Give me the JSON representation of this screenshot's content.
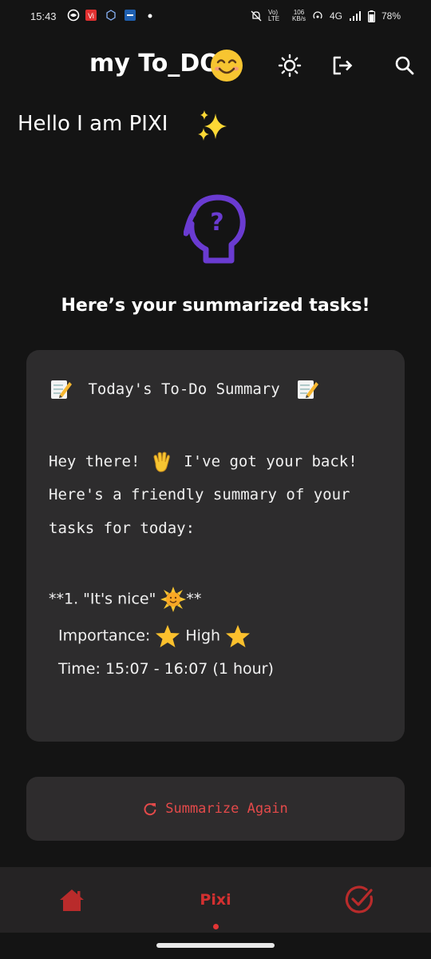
{
  "status_bar": {
    "time": "15:43",
    "net_label": "Vo) LTE",
    "speed_value": "106",
    "speed_unit": "KB/s",
    "network": "4G",
    "battery": "78%"
  },
  "app_bar": {
    "title": "my To_DO",
    "title_emoji": "smiling-face-emoji",
    "actions": [
      "sun-icon",
      "logout-icon",
      "search-icon"
    ]
  },
  "greeting": "Hello I am PIXI",
  "subtitle": "Here’s your summarized tasks!",
  "summary": {
    "heading": "Today's To-Do Summary",
    "line1a": "Hey there!",
    "line1b": "I've got your back!",
    "line2": "Here's a friendly summary of your",
    "line3": "tasks for today:",
    "task_prefix": "**1. \"It's nice\"",
    "task_suffix": "**",
    "importance_label": "Importance:",
    "importance_value": "High",
    "time_line": "Time: 15:07 - 16:07 (1 hour)"
  },
  "summarize_button": "Summarize Again",
  "bottom_nav": {
    "center_label": "Pixi",
    "items": [
      "home-icon",
      "pixi",
      "check-circle-icon"
    ]
  },
  "colors": {
    "background": "#141414",
    "card": "#2d2c2d",
    "accent_red": "#d33030",
    "head_purple": "#6a3bd1"
  }
}
